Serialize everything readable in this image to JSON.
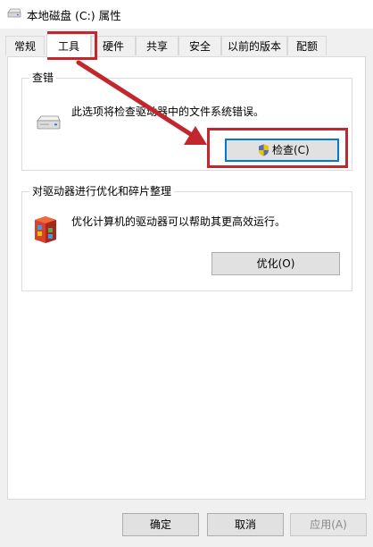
{
  "window": {
    "title": "本地磁盘 (C:) 属性",
    "icon": "drive-icon"
  },
  "tabs": [
    {
      "label": "常规"
    },
    {
      "label": "工具",
      "active": true
    },
    {
      "label": "硬件"
    },
    {
      "label": "共享"
    },
    {
      "label": "安全"
    },
    {
      "label": "以前的版本"
    },
    {
      "label": "配额"
    }
  ],
  "check": {
    "group_title": "查错",
    "description": "此选项将检查驱动器中的文件系统错误。",
    "button_label": "检查(C)",
    "button_icon": "uac-shield-icon"
  },
  "optimize": {
    "group_title": "对驱动器进行优化和碎片整理",
    "description": "优化计算机的驱动器可以帮助其更高效运行。",
    "button_label": "优化(O)",
    "icon": "defrag-icon"
  },
  "footer": {
    "ok_label": "确定",
    "cancel_label": "取消",
    "apply_label": "应用(A)"
  },
  "annotation": {
    "color": "#c1272d"
  }
}
